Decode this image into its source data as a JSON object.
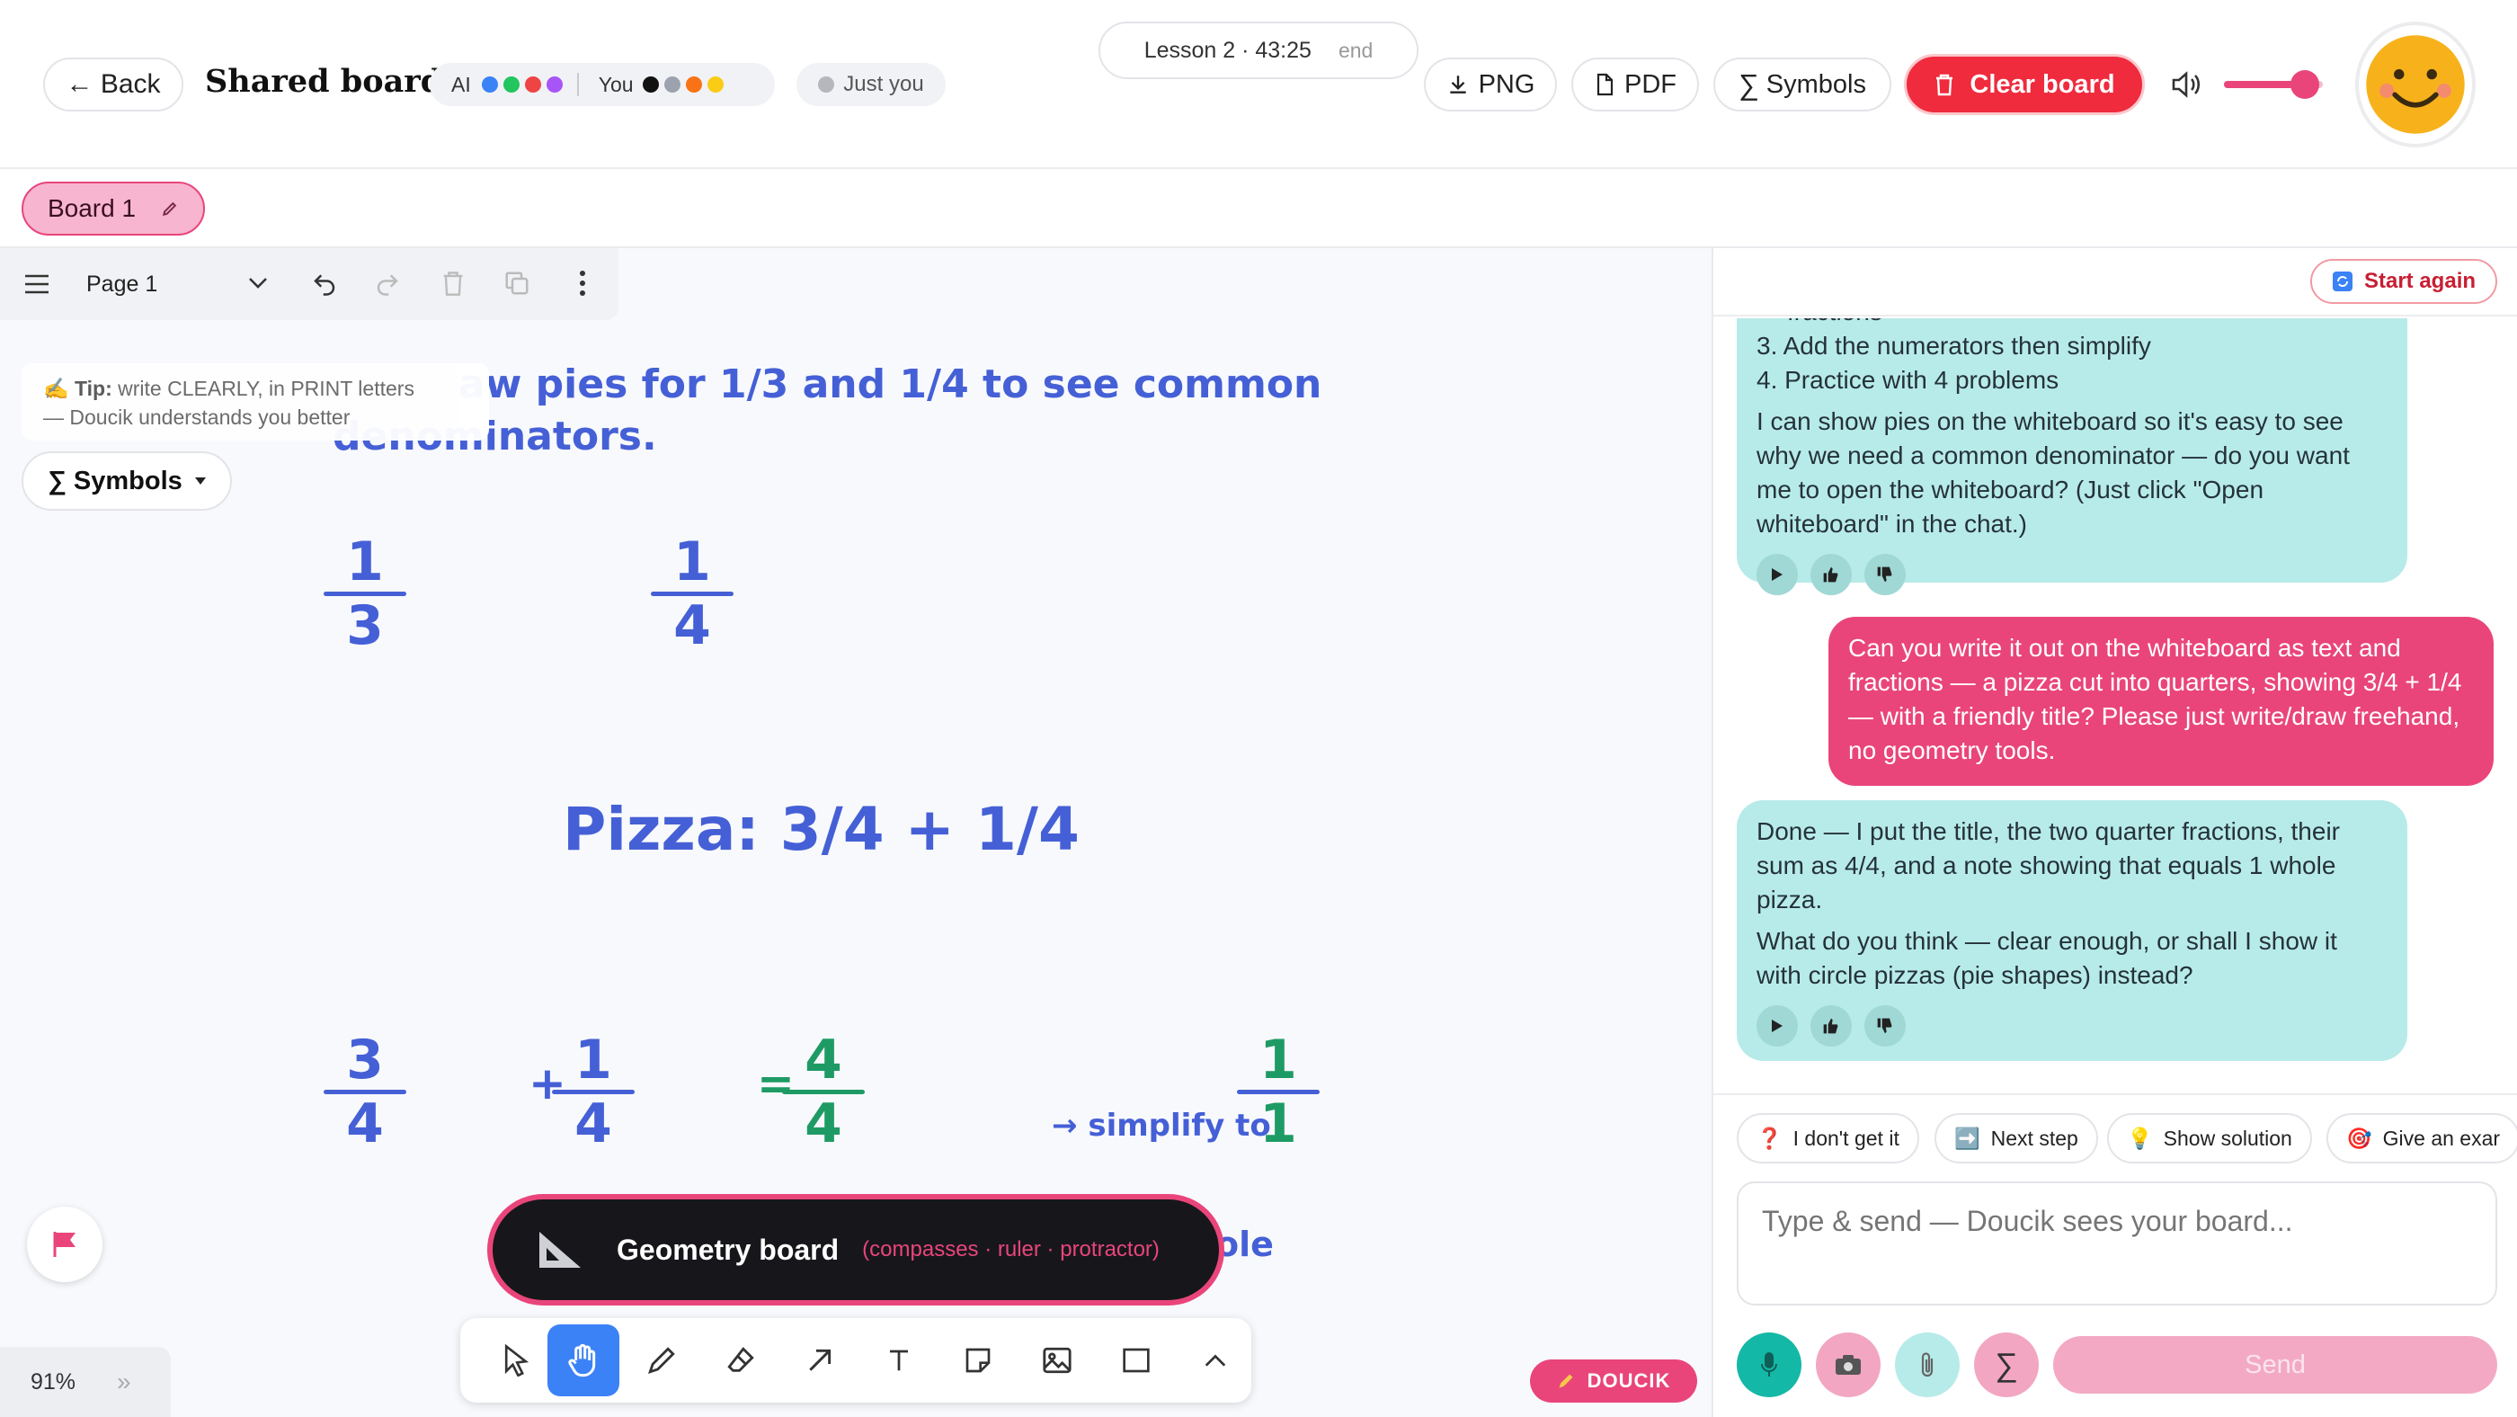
{
  "header": {
    "back_label": "← Back",
    "title": "Shared board",
    "ai_label": "AI",
    "ai_colors": [
      "#3b82f6",
      "#22c55e",
      "#ef4444",
      "#a855f7"
    ],
    "you_label": "You",
    "you_colors": [
      "#111111",
      "#9ca3af",
      "#f97316",
      "#facc15"
    ],
    "presence_label": "Just you",
    "lesson_label": "Lesson 2 · 43:25",
    "end_label": "end",
    "png_label": "PNG",
    "pdf_label": "PDF",
    "symbols_label": "Symbols",
    "symbols_glyph": "∑",
    "clear_label": "Clear board",
    "volume": 0.82,
    "accent": "#ef2b3d"
  },
  "boards": {
    "active_label": "Board 1"
  },
  "canvas": {
    "page_label": "Page 1",
    "tip_prefix": "✍️ Tip:",
    "tip_text": "write CLEARLY, in PRINT letters",
    "tip_line2": "— Doucik understands you better",
    "symbols_label": "Symbols",
    "symbols_glyph": "∑",
    "instruction_line1": "aw pies for 1/3 and 1/4 to see common",
    "instruction_line2": "denominators.",
    "fractions_top": [
      {
        "num": "1",
        "den": "3"
      },
      {
        "num": "1",
        "den": "4"
      }
    ],
    "pizza_title": "Pizza: 3/4 + 1/4",
    "sum": {
      "a_num": "3",
      "a_den": "4",
      "plus": "+",
      "b_num": "1",
      "b_den": "4",
      "eq": "=",
      "r_num": "4",
      "r_den": "4"
    },
    "simplify_label": "→ simplify to",
    "simplified": {
      "num": "1",
      "den": "1"
    },
    "whole_fragment": "ole",
    "geometry_title": "Geometry board",
    "geometry_sub": "(compasses · ruler · protractor)",
    "zoom": "91%",
    "zoom_expand": "»",
    "doucik_label": "DOUCIK",
    "ink_blue": "#4560d6",
    "ink_green": "#1e9b64"
  },
  "chat": {
    "start_again_label": "Start again",
    "msg1_cut": "fractions",
    "msg1_item3": "3. Add the numerators then simplify",
    "msg1_item4": "4. Practice with 4 problems",
    "msg1_para": "I can show pies on the whiteboard so it's easy to see why we need a common denominator — do you want me to open the whiteboard? (Just click \"Open whiteboard\" in the chat.)",
    "msg2": "Can you write it out on the whiteboard as text and fractions — a pizza cut into quarters, showing 3/4 + 1/4 — with a friendly title? Please just write/draw freehand, no geometry tools.",
    "msg3_p1": "Done — I put the title, the two quarter fractions, their sum as 4/4, and a note showing that equals 1 whole pizza.",
    "msg3_p2": "What do you think — clear enough, or shall I show it with circle pizzas (pie shapes) instead?",
    "chips": [
      {
        "icon": "❓",
        "label": "I don't get it"
      },
      {
        "icon": "➡️",
        "label": "Next step"
      },
      {
        "icon": "💡",
        "label": "Show solution"
      },
      {
        "icon": "🎯",
        "label": "Give an exar"
      }
    ],
    "input_placeholder": "Type & send — Doucik sees your board...",
    "sigma": "∑",
    "send_label": "Send"
  }
}
